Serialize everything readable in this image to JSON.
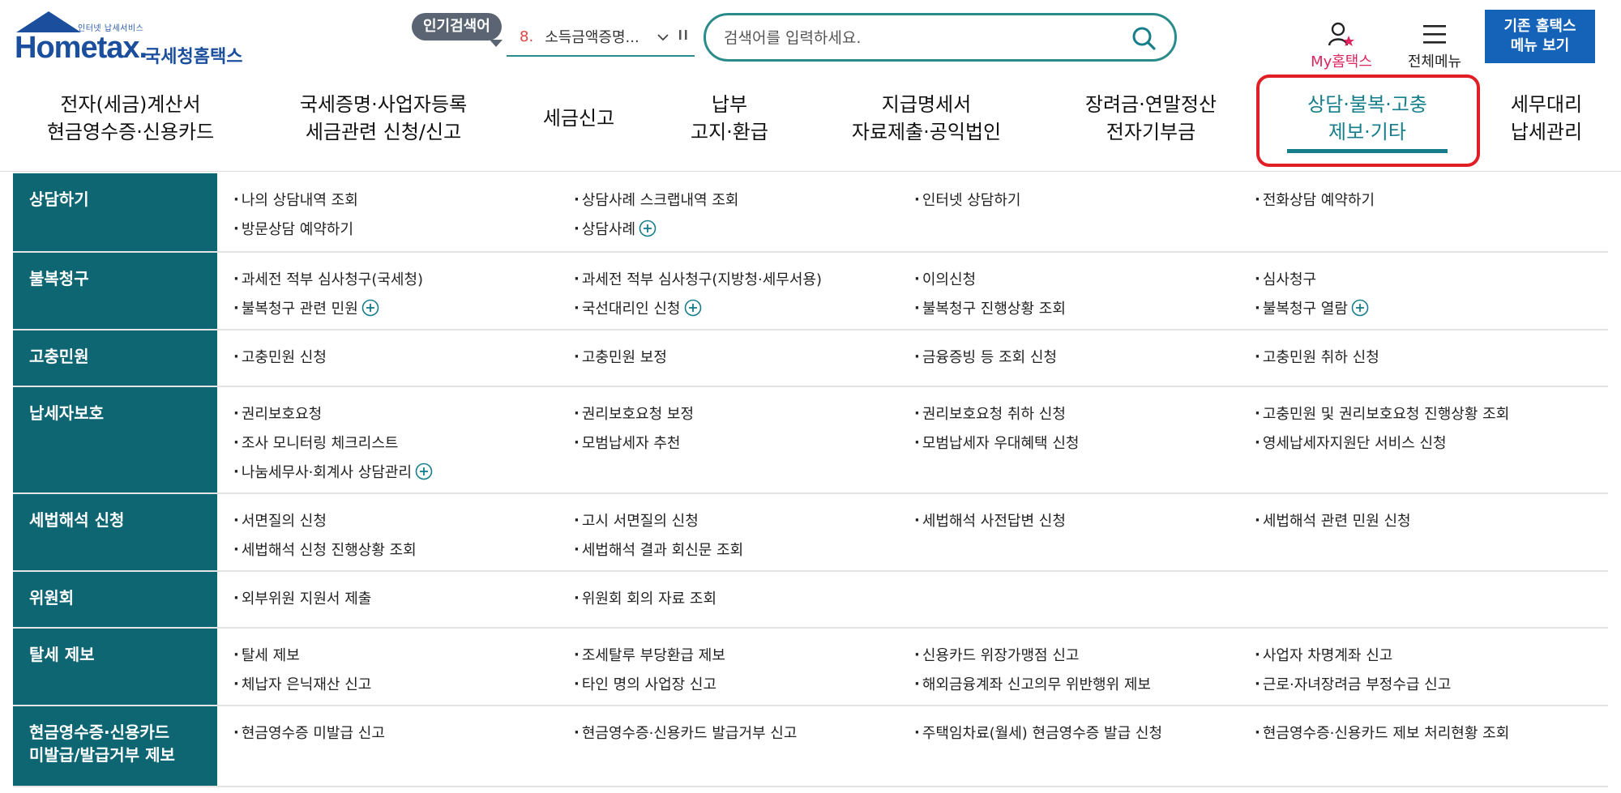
{
  "header": {
    "logo_small": "인터넷 납세서비스",
    "logo_word": "Hometax.",
    "logo_kr": "국세청홈택스",
    "popular_badge": "인기검색어",
    "popular_num": "8.",
    "popular_text": "소득금액증명...",
    "search_placeholder": "검색어를 입력하세요.",
    "my_label": "My홈택스",
    "menu_label": "전체메뉴",
    "old_line1": "기존 홈택스",
    "old_line2": "메뉴 보기"
  },
  "gnb": [
    {
      "l1": "전자(세금)계산서",
      "l2": "현금영수증·신용카드"
    },
    {
      "l1": "국세증명·사업자등록",
      "l2": "세금관련 신청/신고"
    },
    {
      "l1": "세금신고",
      "l2": ""
    },
    {
      "l1": "납부",
      "l2": "고지·환급"
    },
    {
      "l1": "지급명세서",
      "l2": "자료제출·공익법인"
    },
    {
      "l1": "장려금·연말정산",
      "l2": "전자기부금"
    },
    {
      "l1": "상담·불복·고충",
      "l2": "제보·기타"
    },
    {
      "l1": "세무대리",
      "l2": "납세관리"
    }
  ],
  "categories": [
    {
      "name": [
        "상담하기"
      ],
      "links": [
        {
          "t": "나의 상담내역 조회"
        },
        {
          "t": "상담사례 스크랩내역 조회"
        },
        {
          "t": "인터넷 상담하기"
        },
        {
          "t": "전화상담 예약하기"
        },
        {
          "t": "방문상담 예약하기"
        },
        {
          "t": "상담사례",
          "plus": true
        }
      ]
    },
    {
      "name": [
        "불복청구"
      ],
      "links": [
        {
          "t": "과세전 적부 심사청구(국세청)"
        },
        {
          "t": "과세전 적부 심사청구(지방청·세무서용)"
        },
        {
          "t": "이의신청"
        },
        {
          "t": "심사청구"
        },
        {
          "t": "불복청구 관련 민원",
          "plus": true
        },
        {
          "t": "국선대리인 신청",
          "plus": true
        },
        {
          "t": "불복청구 진행상황 조회"
        },
        {
          "t": "불복청구 열람",
          "plus": true
        }
      ]
    },
    {
      "name": [
        "고충민원"
      ],
      "links": [
        {
          "t": "고충민원 신청"
        },
        {
          "t": "고충민원 보정"
        },
        {
          "t": "금융증빙 등 조회 신청"
        },
        {
          "t": "고충민원 취하 신청"
        }
      ]
    },
    {
      "name": [
        "납세자보호"
      ],
      "links": [
        {
          "t": "권리보호요청"
        },
        {
          "t": "권리보호요청 보정"
        },
        {
          "t": "권리보호요청 취하 신청"
        },
        {
          "t": "고충민원 및 권리보호요청 진행상황 조회"
        },
        {
          "t": "조사 모니터링 체크리스트"
        },
        {
          "t": "모범납세자 추천"
        },
        {
          "t": "모범납세자 우대혜택 신청"
        },
        {
          "t": "영세납세자지원단 서비스 신청"
        },
        {
          "t": "나눔세무사·회계사 상담관리",
          "plus": true
        }
      ]
    },
    {
      "name": [
        "세법해석 신청"
      ],
      "links": [
        {
          "t": "서면질의 신청"
        },
        {
          "t": "고시 서면질의 신청"
        },
        {
          "t": "세법해석 사전답변 신청"
        },
        {
          "t": "세법해석 관련 민원 신청"
        },
        {
          "t": "세법해석 신청 진행상황 조회"
        },
        {
          "t": "세법해석 결과 회신문 조회"
        }
      ]
    },
    {
      "name": [
        "위원회"
      ],
      "links": [
        {
          "t": "외부위원 지원서 제출"
        },
        {
          "t": "위원회 회의 자료 조회"
        }
      ]
    },
    {
      "name": [
        "탈세 제보"
      ],
      "links": [
        {
          "t": "탈세 제보"
        },
        {
          "t": "조세탈루 부당환급 제보"
        },
        {
          "t": "신용카드 위장가맹점 신고"
        },
        {
          "t": "사업자 차명계좌 신고"
        },
        {
          "t": "체납자 은닉재산 신고"
        },
        {
          "t": "타인 명의 사업장 신고"
        },
        {
          "t": "해외금융계좌 신고의무 위반행위 제보"
        },
        {
          "t": "근로·자녀장려금 부정수급 신고"
        }
      ]
    },
    {
      "name": [
        "현금영수증·신용카드",
        "미발급/발급거부 제보"
      ],
      "links": [
        {
          "t": "현금영수증 미발급 신고"
        },
        {
          "t": "현금영수증·신용카드 발급거부 신고"
        },
        {
          "t": "주택임차료(월세) 현금영수증 발급 신청"
        },
        {
          "t": "현금영수증·신용카드 제보 처리현황 조회"
        }
      ]
    }
  ]
}
